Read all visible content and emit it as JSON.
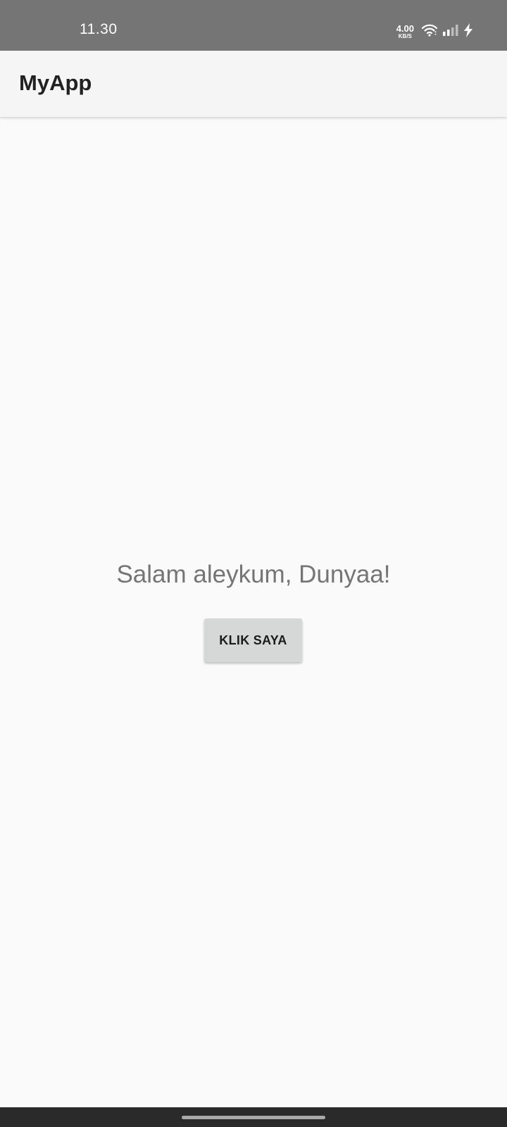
{
  "status_bar": {
    "time": "11.30",
    "net_speed_value": "4.00",
    "net_speed_unit": "KB/S",
    "icons": [
      "wifi-icon",
      "signal-icon",
      "charging-icon"
    ]
  },
  "app_bar": {
    "title": "MyApp"
  },
  "main": {
    "greeting": "Salam aleykum, Dunyaa!",
    "button_label": "KLIK SAYA"
  },
  "colors": {
    "status_bar_bg": "#757575",
    "app_bar_bg": "#f5f5f5",
    "page_bg": "#fafafa",
    "button_bg": "#d6d7d7",
    "greeting_text": "#757575"
  }
}
